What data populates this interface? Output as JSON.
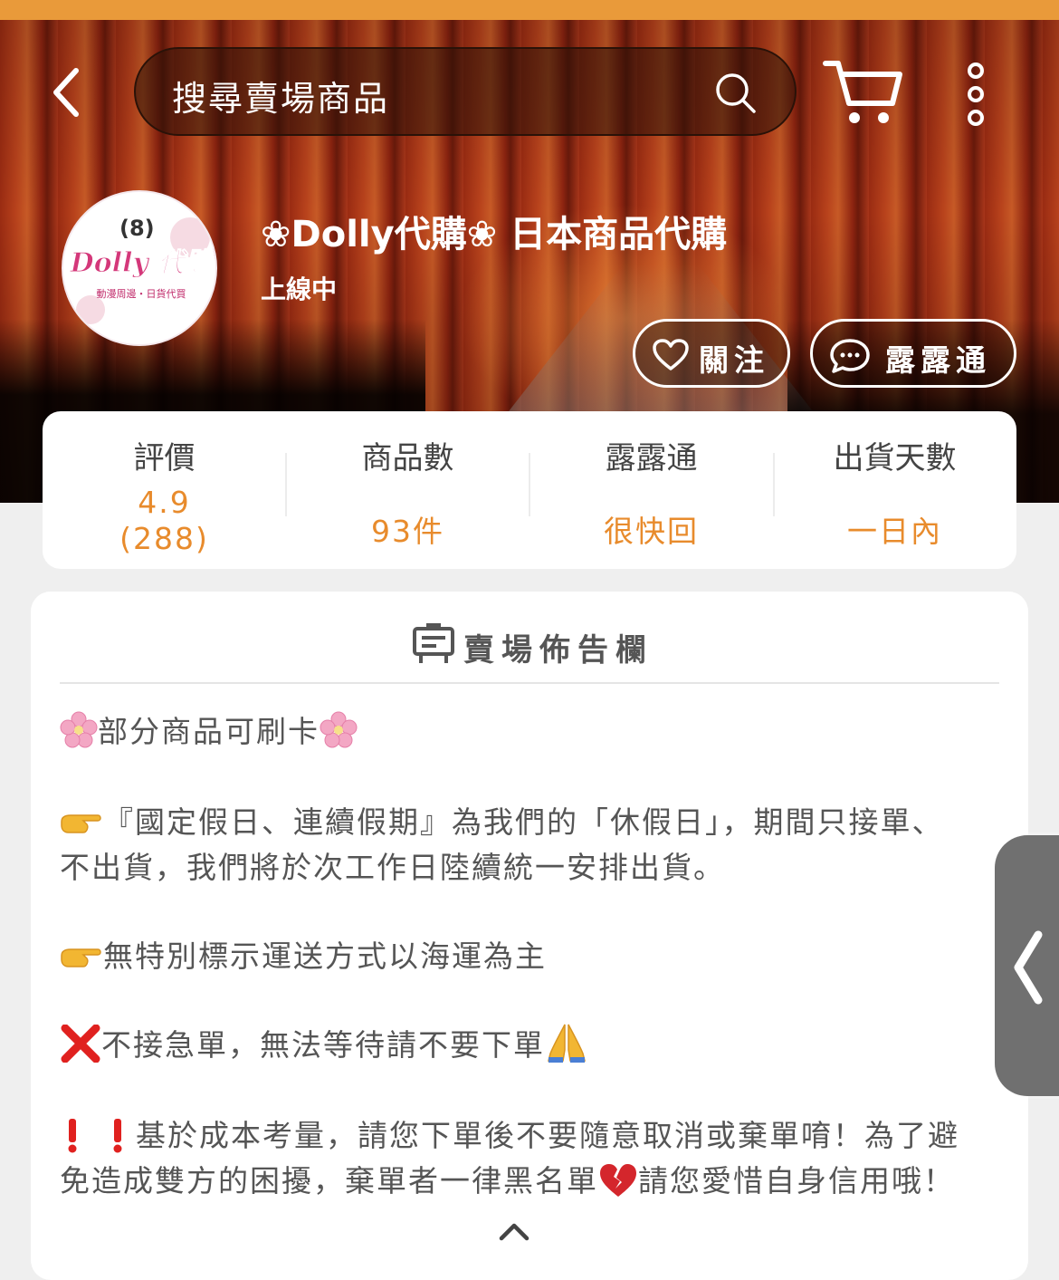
{
  "header": {
    "search_placeholder": "搜尋賣場商品",
    "icons": [
      "back-arrow-icon",
      "search-icon",
      "cart-icon",
      "more-vertical-icon"
    ]
  },
  "shop": {
    "name": "❀Dolly代購❀ 日本商品代購",
    "status": "上線中",
    "avatar_text": "Dolly 代購",
    "avatar_subtext": "動漫周邊・日貨代買",
    "follow_label": "關注",
    "chat_label": "露露通"
  },
  "stats": [
    {
      "label": "評價",
      "value": "4.9",
      "sub": "(288)"
    },
    {
      "label": "商品數",
      "value": "93件"
    },
    {
      "label": "露露通",
      "value": "很快回"
    },
    {
      "label": "出貨天數",
      "value": "一日內"
    }
  ],
  "board": {
    "title": "賣場佈告欄",
    "lines": [
      "部分商品可刷卡",
      "『國定假日、連續假期』為我們的「休假日」，期間只接單、",
      "不出貨，我們將於次工作日陸續統一安排出貨。",
      "無特別標示運送方式以海運為主",
      "不接急單，無法等待請不要下單",
      "基於成本考量，請您下單後不要隨意取消或棄單唷！為了避",
      "免造成雙方的困擾，棄單者一律黑名單",
      "請您愛惜自身信用哦！"
    ]
  },
  "colors": {
    "accent_orange": "#e88b2c",
    "top_bar": "#e99a3a"
  }
}
